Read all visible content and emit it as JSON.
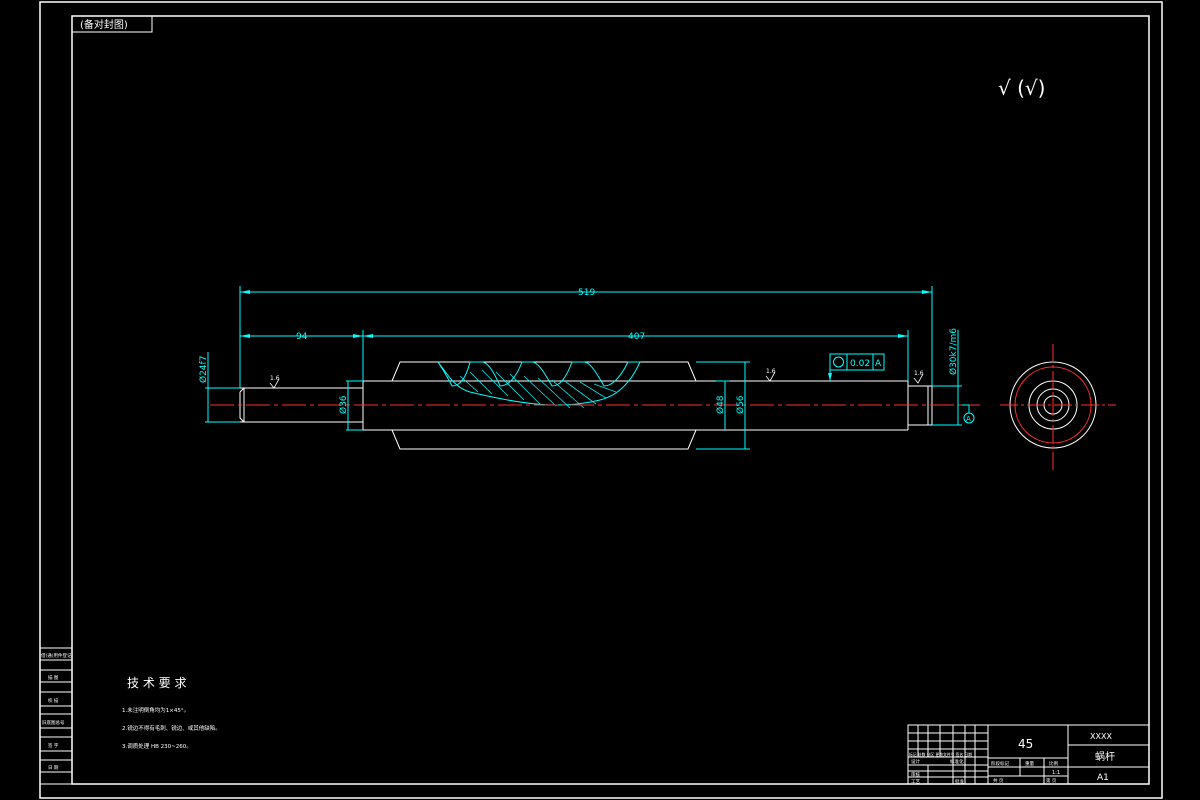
{
  "frame": {
    "corner_label": "(备对封图)"
  },
  "dimensions": {
    "overall_length": "519",
    "left_section": "94",
    "worm_section": "407",
    "dia_left_end": "Ø24f7",
    "dia_left_shoulder": "Ø36",
    "dia_root": "Ø48",
    "dia_outer": "Ø56",
    "dia_right_end": "Ø30k7/m6",
    "tolerance_value": "0.02",
    "datum": "A",
    "roughness_left": "1.6",
    "roughness_mid": "1.6",
    "roughness_right": "1.6"
  },
  "symbols": {
    "general_roughness": "√ (√)"
  },
  "tech_requirements": {
    "heading": "技 术 要 求",
    "items": [
      "1.未注明倒角均为1×45°。",
      "2.锐边不得有毛刺、锐边、或其他缺陷。",
      "3.调质处理 HB 230~260。"
    ]
  },
  "side_strip": {
    "rows": [
      "借(通)用件登记",
      "描 图",
      "校 描",
      "旧底图总号",
      "签 字",
      "日 期"
    ]
  },
  "title_block": {
    "material": "45",
    "company": "XXXX",
    "part_name": "蜗杆",
    "drawing_no": "A1",
    "scale": "1:1",
    "designer_label": "设计",
    "process_label": "工艺",
    "review_label": "审核",
    "std_label": "标准化",
    "approve_label": "批准",
    "stage_label": "阶段标记",
    "weight_label": "重量",
    "scale_label": "比例",
    "sheets_label": "共  页",
    "sheet_label": "第  页",
    "rev_headers": "标记 处数 分区 更改文件号 签名 日期"
  }
}
